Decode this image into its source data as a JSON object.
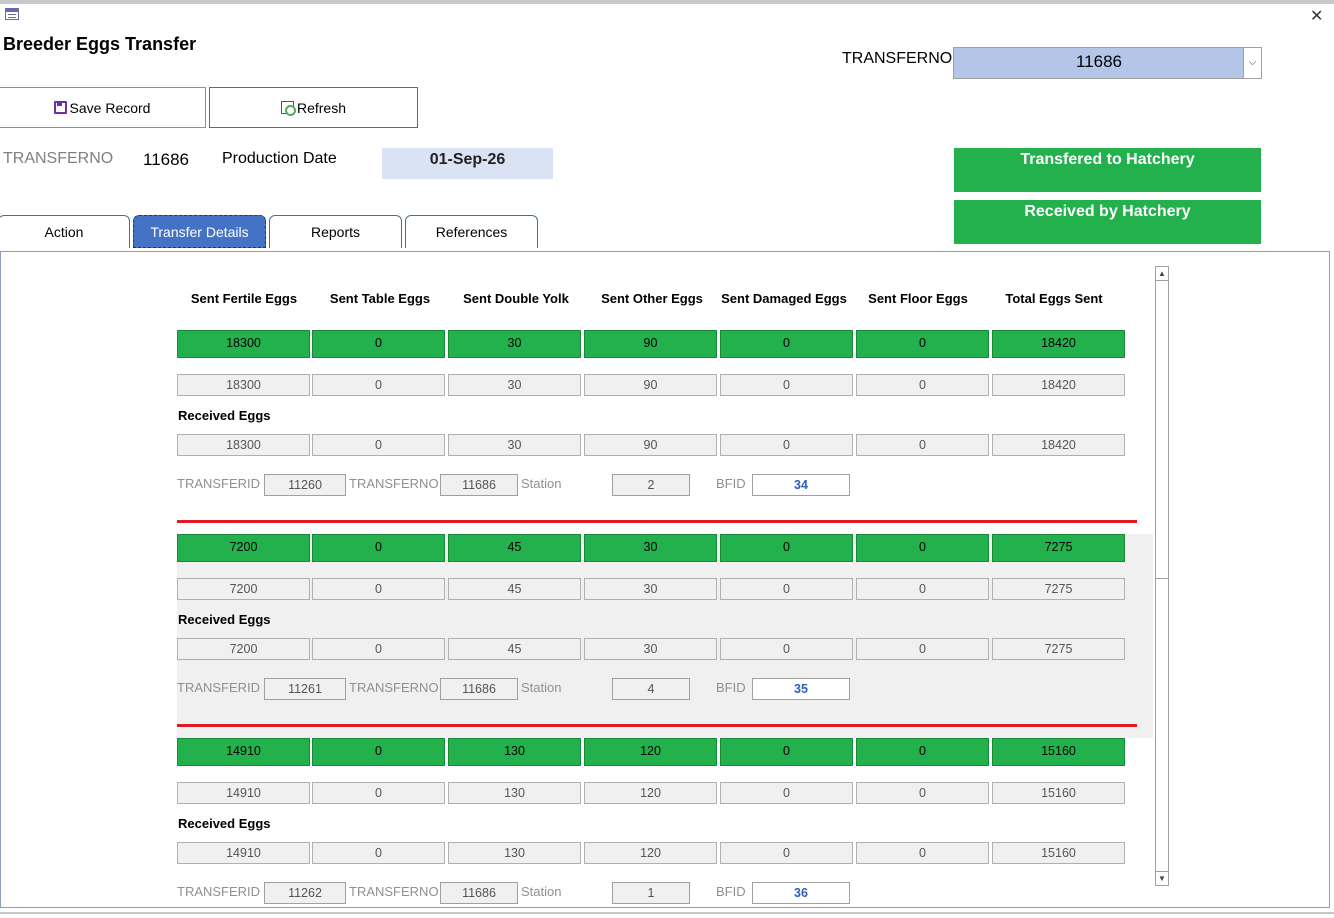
{
  "window": {
    "title": "Breeder Eggs Transfer",
    "close_glyph": "✕"
  },
  "header": {
    "transferno_label": "TRANSFERNO",
    "transferno_value": "11686",
    "combo_arrow": "⌵"
  },
  "toolbar": {
    "save_label": "Save Record",
    "refresh_label": "Refresh"
  },
  "info": {
    "transferno_label": "TRANSFERNO",
    "transferno_value": "11686",
    "production_date_label": "Production Date",
    "production_date_value": "01-Sep-26"
  },
  "status": {
    "transferred": "Transfered to Hatchery",
    "received": "Received by Hatchery"
  },
  "tabs": [
    "Action",
    "Transfer Details",
    "Reports",
    "References"
  ],
  "columns": [
    "Sent Fertile Eggs",
    "Sent  Table Eggs",
    "Sent Double Yolk",
    "Sent Other Eggs",
    "Sent Damaged Eggs",
    "Sent Floor Eggs",
    "Total Eggs Sent"
  ],
  "labels": {
    "received_eggs": "Received Eggs",
    "transferid": "TRANSFERID",
    "transferno": "TRANSFERNO",
    "station": "Station",
    "bfid": "BFID"
  },
  "records": [
    {
      "sent": [
        "18300",
        "0",
        "30",
        "90",
        "0",
        "0",
        "18420"
      ],
      "sent_copy": [
        "18300",
        "0",
        "30",
        "90",
        "0",
        "0",
        "18420"
      ],
      "received": [
        "18300",
        "0",
        "30",
        "90",
        "0",
        "0",
        "18420"
      ],
      "transferid": "11260",
      "transferno": "11686",
      "station": "2",
      "bfid": "34"
    },
    {
      "sent": [
        "7200",
        "0",
        "45",
        "30",
        "0",
        "0",
        "7275"
      ],
      "sent_copy": [
        "7200",
        "0",
        "45",
        "30",
        "0",
        "0",
        "7275"
      ],
      "received": [
        "7200",
        "0",
        "45",
        "30",
        "0",
        "0",
        "7275"
      ],
      "transferid": "11261",
      "transferno": "11686",
      "station": "4",
      "bfid": "35"
    },
    {
      "sent": [
        "14910",
        "0",
        "130",
        "120",
        "0",
        "0",
        "15160"
      ],
      "sent_copy": [
        "14910",
        "0",
        "130",
        "120",
        "0",
        "0",
        "15160"
      ],
      "received": [
        "14910",
        "0",
        "130",
        "120",
        "0",
        "0",
        "15160"
      ],
      "transferid": "11262",
      "transferno": "11686",
      "station": "1",
      "bfid": "36"
    }
  ],
  "scrollbar": {
    "up": "▲",
    "down": "▼"
  }
}
